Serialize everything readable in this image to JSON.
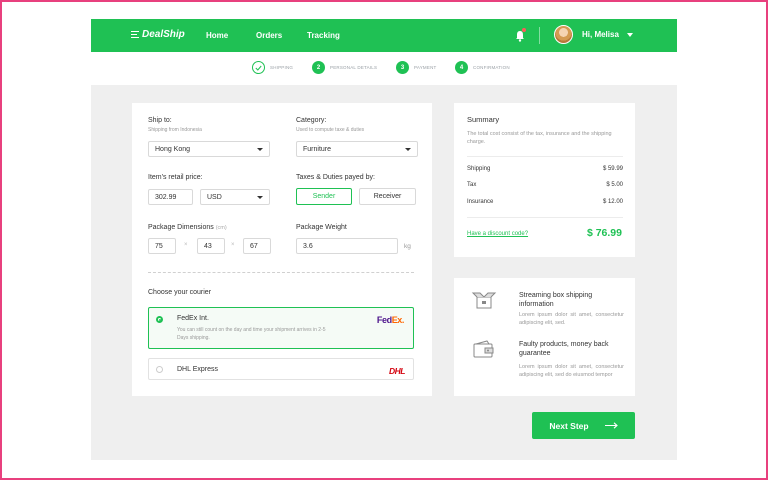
{
  "header": {
    "logo": "DealShip",
    "nav": [
      "Home",
      "Orders",
      "Tracking"
    ],
    "username": "Hi, Melisa"
  },
  "steps": [
    {
      "number": "",
      "label": "SHIPPING",
      "done": true
    },
    {
      "number": "2",
      "label": "PERSONAL DETAILS"
    },
    {
      "number": "3",
      "label": "PAYMENT"
    },
    {
      "number": "4",
      "label": "CONFIRMATION"
    }
  ],
  "form": {
    "ship_to_label": "Ship to:",
    "ship_to_sub": "Shipping from Indonesia",
    "ship_to_value": "Hong Kong",
    "category_label": "Category:",
    "category_sub": "Used to compute taxe & duties",
    "category_value": "Furniture",
    "price_label": "Item's retail price:",
    "price_value": "302.99",
    "currency_value": "USD",
    "taxes_label": "Taxes & Duties payed by:",
    "sender_label": "Sender",
    "receiver_label": "Receiver",
    "dimensions_label": "Package Dimensions",
    "dimensions_unit": "(cm)",
    "dim_1": "75",
    "dim_2": "43",
    "dim_3": "67",
    "times": "×",
    "weight_label": "Package Weight",
    "weight_value": "3.6",
    "weight_unit": "kg",
    "courier_label": "Choose your courier",
    "couriers": [
      {
        "name": "FedEx Int.",
        "desc": "You can still count on the day and time your shipment arrives in 2-5 Days shipping.",
        "logo_a": "Fed",
        "logo_b": "Ex.",
        "selected": true
      },
      {
        "name": "DHL Express",
        "logo": "DHL",
        "selected": false
      }
    ]
  },
  "summary": {
    "title": "Summary",
    "desc": "The total cost consist of the tax, insurance and the shipping charge.",
    "rows": [
      {
        "label": "Shipping",
        "value": "$ 59.99"
      },
      {
        "label": "Tax",
        "value": "$ 5.00"
      },
      {
        "label": "Insurance",
        "value": "$ 12.00"
      }
    ],
    "discount": "Have a discount code?",
    "total": "$ 76.99"
  },
  "info": [
    {
      "icon": "box-icon",
      "title": "Streaming box shipping information",
      "desc": "Lorem ipsum dolor sit amet, consectetur adipiscing elit, sed."
    },
    {
      "icon": "wallet-icon",
      "title": "Faulty products, money back guarantee",
      "desc": "Lorem ipsum dolor sit amet, consectetur adipiscing elit, sed do eiusmod tempor"
    }
  ],
  "next_button": "Next Step",
  "colors": {
    "accent": "#1fc154",
    "frame": "#e8407e"
  }
}
